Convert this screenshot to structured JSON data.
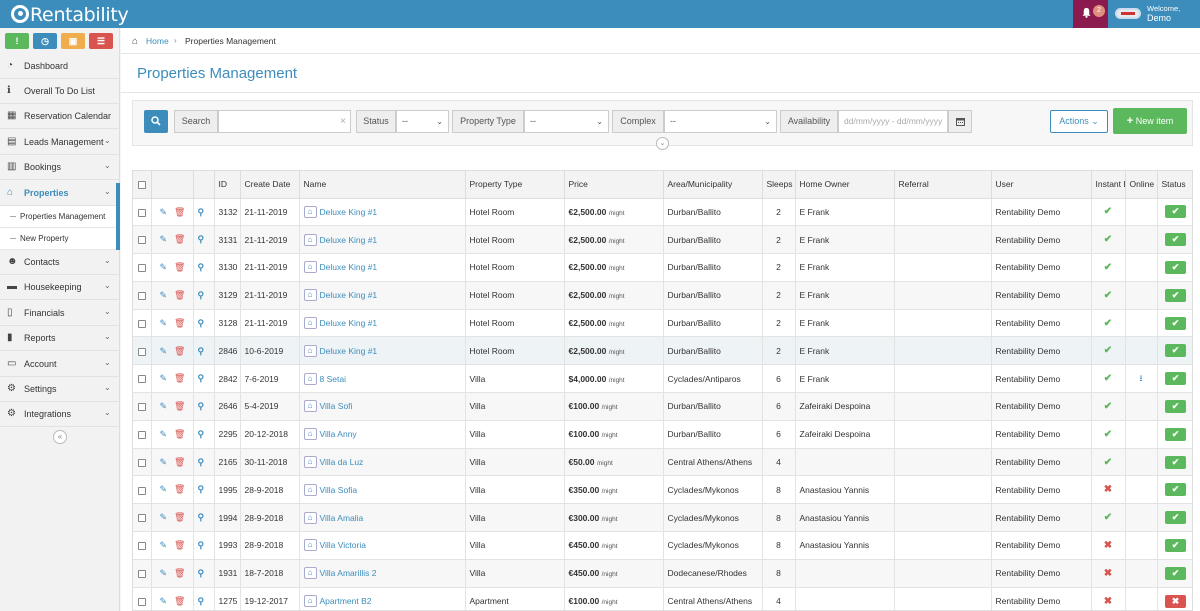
{
  "app": {
    "name": "Rentability"
  },
  "topbar": {
    "notification_count": "2",
    "welcome": "Welcome,",
    "user_name": "Demo"
  },
  "colors": {
    "brand": "#3c8dbc",
    "notif_bg": "#8b1b4e",
    "success": "#5cb85c",
    "danger": "#d9534f"
  },
  "quick_buttons": [
    {
      "icon": "exclamation-icon",
      "glyph": "!",
      "color": "#5cb85c"
    },
    {
      "icon": "clock-icon",
      "glyph": "◷",
      "color": "#3c8dbc"
    },
    {
      "icon": "money-icon",
      "glyph": "▣",
      "color": "#f0ad4e"
    },
    {
      "icon": "list-icon",
      "glyph": "☰",
      "color": "#d9534f"
    }
  ],
  "sidebar": {
    "items": [
      {
        "label": "Dashboard",
        "icon": "dashboard-icon",
        "glyph": "◔",
        "chevron": false
      },
      {
        "label": "Overall To Do List",
        "icon": "info-icon",
        "glyph": "ℹ",
        "chevron": false
      },
      {
        "label": "Reservation Calendar",
        "icon": "calendar-icon",
        "glyph": "▦",
        "chevron": false
      },
      {
        "label": "Leads Management",
        "icon": "id-card-icon",
        "glyph": "▤",
        "chevron": true
      },
      {
        "label": "Bookings",
        "icon": "briefcase-icon",
        "glyph": "▥",
        "chevron": true
      },
      {
        "label": "Properties",
        "icon": "home-icon",
        "glyph": "⌂",
        "chevron": true,
        "active": true
      },
      {
        "label": "Contacts",
        "icon": "users-icon",
        "glyph": "☻",
        "chevron": true
      },
      {
        "label": "Housekeeping",
        "icon": "bed-icon",
        "glyph": "▬",
        "chevron": true
      },
      {
        "label": "Financials",
        "icon": "file-icon",
        "glyph": "▯",
        "chevron": true
      },
      {
        "label": "Reports",
        "icon": "chart-icon",
        "glyph": "▮",
        "chevron": true
      },
      {
        "label": "Account",
        "icon": "monitor-icon",
        "glyph": "▭",
        "chevron": true
      },
      {
        "label": "Settings",
        "icon": "gear-icon",
        "glyph": "⚙",
        "chevron": true
      },
      {
        "label": "Integrations",
        "icon": "cogs-icon",
        "glyph": "⚙",
        "chevron": true
      }
    ],
    "subitems": [
      {
        "label": "Properties Management"
      },
      {
        "label": "New Property"
      }
    ],
    "collapse_glyph": "«"
  },
  "breadcrumb": {
    "home": "Home",
    "separator": "›",
    "current": "Properties Management"
  },
  "page_title": "Properties Management",
  "filters": {
    "search_label": "Search",
    "search_value": "",
    "status_label": "Status",
    "status_value": "--",
    "property_type_label": "Property Type",
    "property_type_value": "--",
    "complex_label": "Complex",
    "complex_value": "--",
    "availability_label": "Availability",
    "availability_placeholder": "dd/mm/yyyy - dd/mm/yyyy",
    "actions_label": "Actions",
    "new_item_label": "New item"
  },
  "table": {
    "columns": [
      "",
      "",
      "",
      "ID",
      "Create Date",
      "Name",
      "Property Type",
      "Price",
      "Area/Municipality",
      "Sleeps",
      "Home Owner",
      "Referral",
      "User",
      "Instant B",
      "Online",
      "Status"
    ],
    "price_unit": "/night",
    "rows": [
      {
        "id": "3132",
        "date": "21-11-2019",
        "name": "Deluxe King #1",
        "type": "Hotel Room",
        "price": "€2,500.00",
        "area": "Durban/Ballito",
        "sleeps": "2",
        "owner": "E Frank",
        "referral": "",
        "user": "Rentability Demo",
        "instant": true,
        "online": false,
        "status": true
      },
      {
        "id": "3131",
        "date": "21-11-2019",
        "name": "Deluxe King #1",
        "type": "Hotel Room",
        "price": "€2,500.00",
        "area": "Durban/Ballito",
        "sleeps": "2",
        "owner": "E Frank",
        "referral": "",
        "user": "Rentability Demo",
        "instant": true,
        "online": false,
        "status": true
      },
      {
        "id": "3130",
        "date": "21-11-2019",
        "name": "Deluxe King #1",
        "type": "Hotel Room",
        "price": "€2,500.00",
        "area": "Durban/Ballito",
        "sleeps": "2",
        "owner": "E Frank",
        "referral": "",
        "user": "Rentability Demo",
        "instant": true,
        "online": false,
        "status": true
      },
      {
        "id": "3129",
        "date": "21-11-2019",
        "name": "Deluxe King #1",
        "type": "Hotel Room",
        "price": "€2,500.00",
        "area": "Durban/Ballito",
        "sleeps": "2",
        "owner": "E Frank",
        "referral": "",
        "user": "Rentability Demo",
        "instant": true,
        "online": false,
        "status": true
      },
      {
        "id": "3128",
        "date": "21-11-2019",
        "name": "Deluxe King #1",
        "type": "Hotel Room",
        "price": "€2,500.00",
        "area": "Durban/Ballito",
        "sleeps": "2",
        "owner": "E Frank",
        "referral": "",
        "user": "Rentability Demo",
        "instant": true,
        "online": false,
        "status": true
      },
      {
        "id": "2846",
        "date": "10-6-2019",
        "name": "Deluxe King #1",
        "type": "Hotel Room",
        "price": "€2,500.00",
        "area": "Durban/Ballito",
        "sleeps": "2",
        "owner": "E Frank",
        "referral": "",
        "user": "Rentability Demo",
        "instant": true,
        "online": false,
        "status": true
      },
      {
        "id": "2842",
        "date": "7-6-2019",
        "name": "8 Setai",
        "type": "Villa",
        "price": "$4,000.00",
        "area": "Cyclades/Antiparos",
        "sleeps": "6",
        "owner": "E Frank",
        "referral": "",
        "user": "Rentability Demo",
        "instant": true,
        "online": true,
        "status": true
      },
      {
        "id": "2646",
        "date": "5-4-2019",
        "name": "Villa Sofi",
        "type": "Villa",
        "price": "€100.00",
        "area": "Durban/Ballito",
        "sleeps": "6",
        "owner": "Zafeiraki Despoina",
        "referral": "",
        "user": "Rentability Demo",
        "instant": true,
        "online": false,
        "status": true
      },
      {
        "id": "2295",
        "date": "20-12-2018",
        "name": "Villa  Anny",
        "type": "Villa",
        "price": "€100.00",
        "area": "Durban/Ballito",
        "sleeps": "6",
        "owner": "Zafeiraki Despoina",
        "referral": "",
        "user": "Rentability Demo",
        "instant": true,
        "online": false,
        "status": true
      },
      {
        "id": "2165",
        "date": "30-11-2018",
        "name": "Villa da Luz",
        "type": "Villa",
        "price": "€50.00",
        "area": "Central Athens/Athens",
        "sleeps": "4",
        "owner": "",
        "referral": "",
        "user": "Rentability Demo",
        "instant": true,
        "online": false,
        "status": true
      },
      {
        "id": "1995",
        "date": "28-9-2018",
        "name": "Villa Sofia",
        "type": "Villa",
        "price": "€350.00",
        "area": "Cyclades/Mykonos",
        "sleeps": "8",
        "owner": "Anastasiou Yannis",
        "referral": "",
        "user": "Rentability Demo",
        "instant": false,
        "online": false,
        "status": true
      },
      {
        "id": "1994",
        "date": "28-9-2018",
        "name": "Villa Amalia",
        "type": "Villa",
        "price": "€300.00",
        "area": "Cyclades/Mykonos",
        "sleeps": "8",
        "owner": "Anastasiou Yannis",
        "referral": "",
        "user": "Rentability Demo",
        "instant": true,
        "online": false,
        "status": true
      },
      {
        "id": "1993",
        "date": "28-9-2018",
        "name": "Villa Victoria",
        "type": "Villa",
        "price": "€450.00",
        "area": "Cyclades/Mykonos",
        "sleeps": "8",
        "owner": "Anastasiou Yannis",
        "referral": "",
        "user": "Rentability Demo",
        "instant": false,
        "online": false,
        "status": true
      },
      {
        "id": "1931",
        "date": "18-7-2018",
        "name": "Villa Amarillis 2",
        "type": "Villa",
        "price": "€450.00",
        "area": "Dodecanese/Rhodes",
        "sleeps": "8",
        "owner": "",
        "referral": "",
        "user": "Rentability Demo",
        "instant": false,
        "online": false,
        "status": true
      },
      {
        "id": "1275",
        "date": "19-12-2017",
        "name": "Apartment B2",
        "type": "Apartment",
        "price": "€100.00",
        "area": "Central Athens/Athens",
        "sleeps": "4",
        "owner": "",
        "referral": "",
        "user": "Rentability Demo",
        "instant": false,
        "online": false,
        "status": false
      }
    ]
  }
}
